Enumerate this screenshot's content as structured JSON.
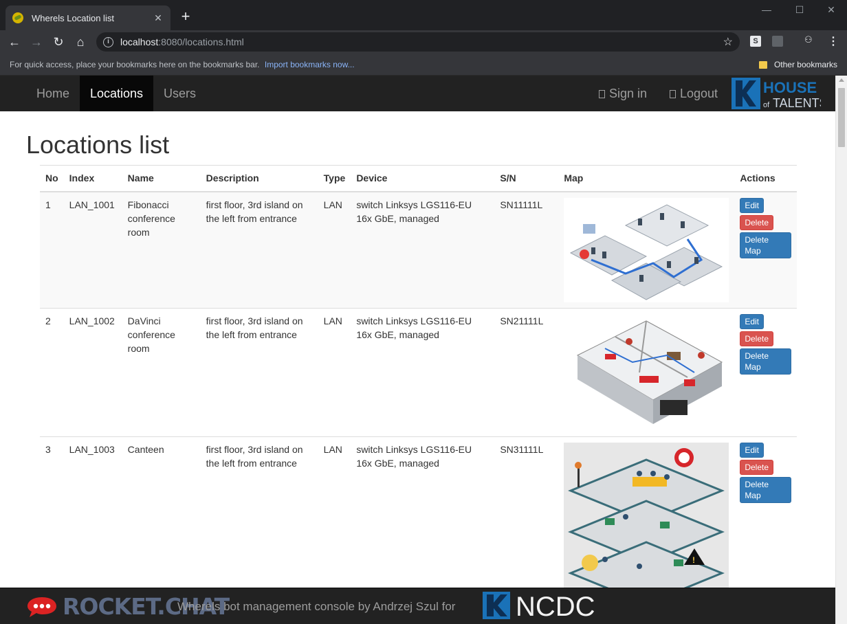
{
  "browser": {
    "tab_title": "Wherels Location list",
    "url_host": "localhost",
    "url_rest": ":8080/locations.html",
    "bookmarks_message": "For quick access, place your bookmarks here on the bookmarks bar.",
    "bookmarks_import": "Import bookmarks now...",
    "other_bookmarks": "Other bookmarks"
  },
  "navbar": {
    "items": [
      {
        "label": "Home"
      },
      {
        "label": "Locations"
      },
      {
        "label": "Users"
      }
    ],
    "signin": "Sign in",
    "logout": "Logout",
    "logo_text_top": "HOUSE",
    "logo_text_bottom_small": "of",
    "logo_text_bottom": "TALENTS"
  },
  "page": {
    "title": "Locations list"
  },
  "table": {
    "headers": [
      "No",
      "Index",
      "Name",
      "Description",
      "Type",
      "Device",
      "S/N",
      "Map",
      "Actions"
    ],
    "rows": [
      {
        "no": "1",
        "index": "LAN_1001",
        "name": "Fibonacci conference room",
        "description": "first floor, 3rd island on the left from entrance",
        "type": "LAN",
        "device": "switch Linksys LGS116-EU 16x GbE, managed",
        "sn": "SN11111L"
      },
      {
        "no": "2",
        "index": "LAN_1002",
        "name": "DaVinci conference room",
        "description": "first floor, 3rd island on the left from entrance",
        "type": "LAN",
        "device": "switch Linksys LGS116-EU 16x GbE, managed",
        "sn": "SN21111L"
      },
      {
        "no": "3",
        "index": "LAN_1003",
        "name": "Canteen",
        "description": "first floor, 3rd island on the left from entrance",
        "type": "LAN",
        "device": "switch Linksys LGS116-EU 16x GbE, managed",
        "sn": "SN31111L"
      }
    ],
    "actions": {
      "edit": "Edit",
      "delete": "Delete",
      "delete_map": "Delete Map"
    }
  },
  "footer": {
    "rocket_chat": "ROCKET.CHAT",
    "text": "Wherels bot management console by Andrzej Szul for",
    "ncdc": "NCDC"
  },
  "colors": {
    "navbar": "#222222",
    "primary": "#337ab7",
    "danger": "#d9534f",
    "rocket_red": "#db2323"
  }
}
